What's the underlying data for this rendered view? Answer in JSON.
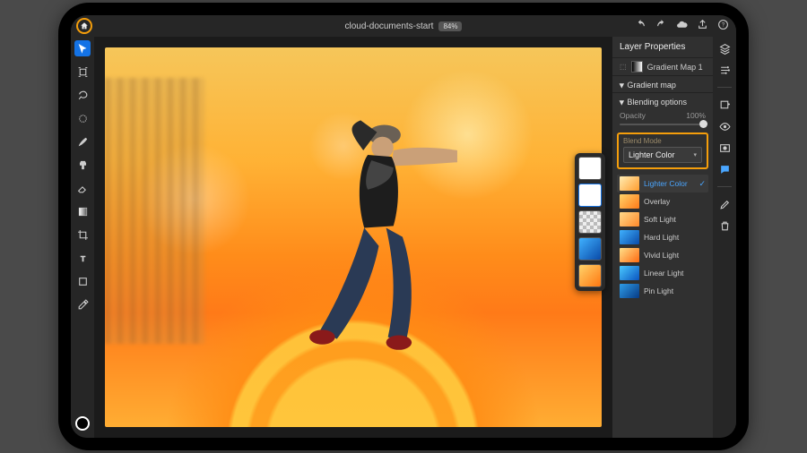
{
  "header": {
    "doc_title": "cloud-documents-start",
    "zoom": "84%"
  },
  "left_tools": [
    {
      "name": "move",
      "selected": true
    },
    {
      "name": "transform"
    },
    {
      "name": "lasso"
    },
    {
      "name": "brush-selection"
    },
    {
      "name": "brush"
    },
    {
      "name": "clone-stamp"
    },
    {
      "name": "eraser"
    },
    {
      "name": "gradient"
    },
    {
      "name": "crop"
    },
    {
      "name": "type"
    },
    {
      "name": "shape"
    },
    {
      "name": "eyedropper"
    }
  ],
  "panel": {
    "title": "Layer Properties",
    "layer_name": "Gradient Map 1",
    "section_gradient": "Gradient map",
    "section_blending": "Blending options",
    "opacity_label": "Opacity",
    "opacity_value": "100%",
    "blend_label": "Blend Mode",
    "blend_value": "Lighter Color"
  },
  "blend_modes": [
    {
      "label": "Lighter Color",
      "selected": true,
      "sw": "linear-gradient(135deg,#ffedb3,#ff9d2e)"
    },
    {
      "label": "Overlay",
      "sw": "linear-gradient(135deg,#ffd36a,#ff7a18)"
    },
    {
      "label": "Soft Light",
      "sw": "linear-gradient(135deg,#ffd98a,#ff8a2a)"
    },
    {
      "label": "Hard Light",
      "sw": "linear-gradient(135deg,#3fb1ff,#0a4aa8)"
    },
    {
      "label": "Vivid Light",
      "sw": "linear-gradient(135deg,#ffe08a,#ff6a10)"
    },
    {
      "label": "Linear Light",
      "sw": "linear-gradient(135deg,#4ac8ff,#0a55c0)"
    },
    {
      "label": "Pin Light",
      "sw": "linear-gradient(135deg,#2e9de8,#073a85)"
    }
  ],
  "float_thumbs": [
    {
      "sel": false,
      "bg": "#fff"
    },
    {
      "sel": true,
      "bg": "#ffffff"
    },
    {
      "sel": false,
      "bg": "repeating-conic-gradient(#bbb 0 25%, #eee 0 50%) 0 0/8px 8px"
    },
    {
      "sel": false,
      "bg": "linear-gradient(135deg,#3fb1ff,#0a4aa8)"
    },
    {
      "sel": false,
      "bg": "linear-gradient(135deg,#ffd36a,#ff7710)"
    }
  ]
}
